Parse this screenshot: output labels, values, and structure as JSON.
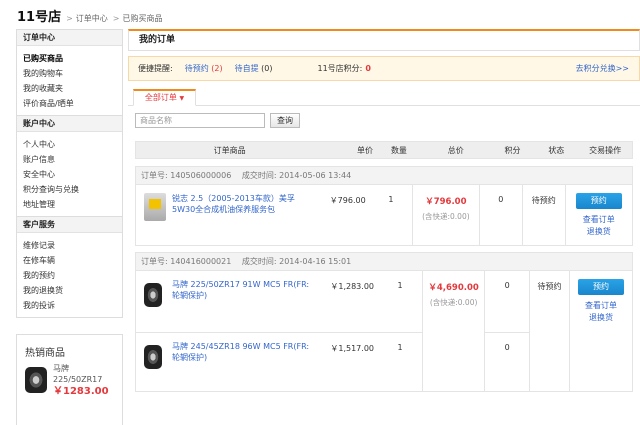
{
  "breadcrumb": {
    "store": "11号店",
    "level1": "订单中心",
    "level2": "已购买商品"
  },
  "sidebar": {
    "sections": [
      {
        "title": "订单中心",
        "items": [
          "已购买商品",
          "我的购物车",
          "我的收藏夹",
          "评价商品/晒单"
        ]
      },
      {
        "title": "账户中心",
        "items": [
          "个人中心",
          "账户信息",
          "安全中心",
          "积分查询与兑换",
          "地址管理"
        ]
      },
      {
        "title": "客户服务",
        "items": [
          "维修记录",
          "在修车辆",
          "我的预约",
          "我的退换货",
          "我的投诉"
        ]
      }
    ],
    "hot": {
      "title": "热销商品",
      "item_name": "马牌 225/50ZR17",
      "item_price": "￥1283.00"
    }
  },
  "main": {
    "title": "我的订单",
    "remind": {
      "label": "便捷提醒:",
      "pending_reserve": "待预约",
      "pending_reserve_count": "(2)",
      "pending_pickup": "待自提",
      "pending_pickup_count": "(0)",
      "points_label": "11号店积分:",
      "points_value": "0",
      "redeem_link": "去积分兑换>>"
    },
    "tab": "全部订单",
    "search": {
      "placeholder": "商品名称",
      "button": "查询"
    },
    "columns": [
      "订单商品",
      "单价",
      "数量",
      "总价",
      "积分",
      "状态",
      "交易操作"
    ],
    "orders": [
      {
        "order_no_label": "订单号:",
        "order_no": "140506000006",
        "date_label": "成交时间:",
        "date": "2014-05-06 13:44",
        "total": "￥796.00",
        "shipping": "(含快递:0.00)",
        "status": "待预约",
        "action_button": "预约",
        "action_link1": "查看订单",
        "action_link2": "退换货",
        "products": [
          {
            "name": "锐志 2.5（2005-2013车款）美孚5W30全合成机油保养服务包",
            "price": "￥796.00",
            "qty": "1",
            "points": "0",
            "image": "oil-icon"
          }
        ]
      },
      {
        "order_no_label": "订单号:",
        "order_no": "140416000021",
        "date_label": "成交时间:",
        "date": "2014-04-16 15:01",
        "total": "￥4,690.00",
        "shipping": "(含快递:0.00)",
        "status": "待预约",
        "action_button": "预约",
        "action_link1": "查看订单",
        "action_link2": "退换货",
        "products": [
          {
            "name": "马牌 225/50ZR17 91W MC5 FR(FR:轮辋保护)",
            "price": "￥1,283.00",
            "qty": "1",
            "points": "0",
            "image": "tire-icon"
          },
          {
            "name": "马牌 245/45ZR18 96W MC5 FR(FR:轮辋保护)",
            "price": "￥1,517.00",
            "qty": "1",
            "points": "0",
            "image": "tire-icon"
          }
        ]
      }
    ]
  }
}
